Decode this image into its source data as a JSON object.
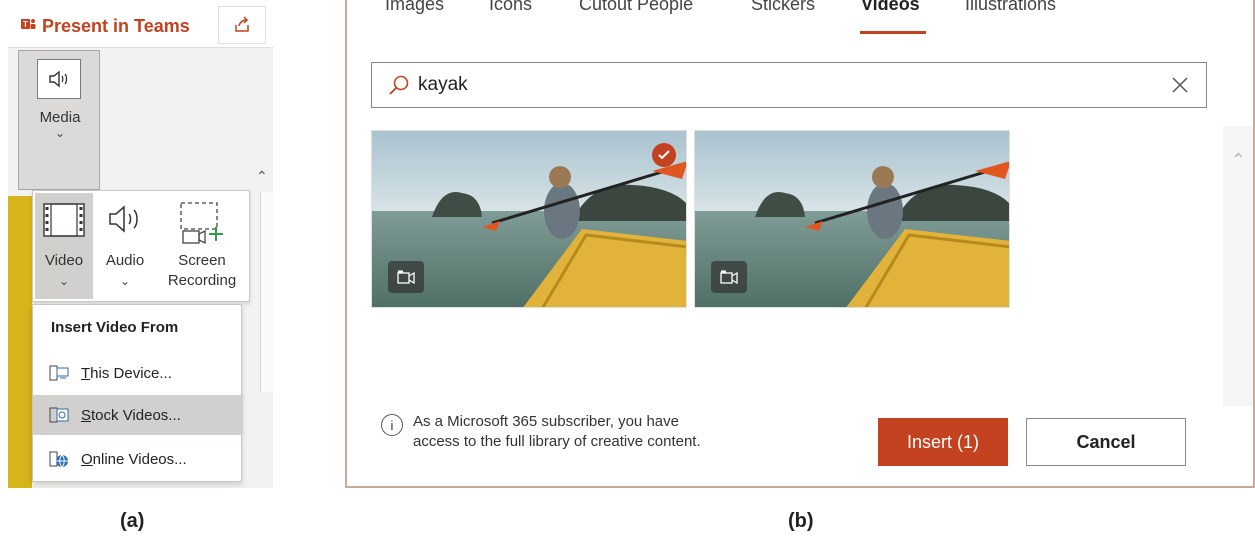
{
  "panel_a": {
    "present_in_teams": "Present in Teams",
    "media_label": "Media",
    "dropdown": {
      "video": "Video",
      "audio": "Audio",
      "screen_recording_line1": "Screen",
      "screen_recording_line2": "Recording"
    },
    "insert_menu": {
      "header": "Insert Video From",
      "items": [
        {
          "label": "This Device...",
          "underline": "T",
          "rest": "his Device...",
          "icon": "device-video-icon",
          "selected": false
        },
        {
          "label": "Stock Videos...",
          "underline": "S",
          "rest": "tock Videos...",
          "icon": "stock-video-icon",
          "selected": true
        },
        {
          "label": "Online Videos...",
          "underline": "O",
          "rest": "nline Videos...",
          "icon": "online-video-icon",
          "selected": false
        }
      ]
    },
    "caption": "(a)"
  },
  "panel_b": {
    "tabs": [
      "Images",
      "Icons",
      "Cutout People",
      "Stickers",
      "Videos",
      "Illustrations"
    ],
    "active_tab": "Videos",
    "search": {
      "value": "kayak"
    },
    "thumbnails": [
      {
        "selected": true,
        "icon": "video-camera-icon"
      },
      {
        "selected": false,
        "icon": "video-camera-icon"
      }
    ],
    "info_text_line1": "As a Microsoft 365 subscriber, you have",
    "info_text_line2": "access to the full library of creative content.",
    "insert_button": "Insert (1)",
    "cancel_button": "Cancel",
    "caption": "(b)"
  },
  "colors": {
    "accent": "#c4421f",
    "panel_bg": "#f3f2f1",
    "selected_bg": "#d2d0ce"
  }
}
